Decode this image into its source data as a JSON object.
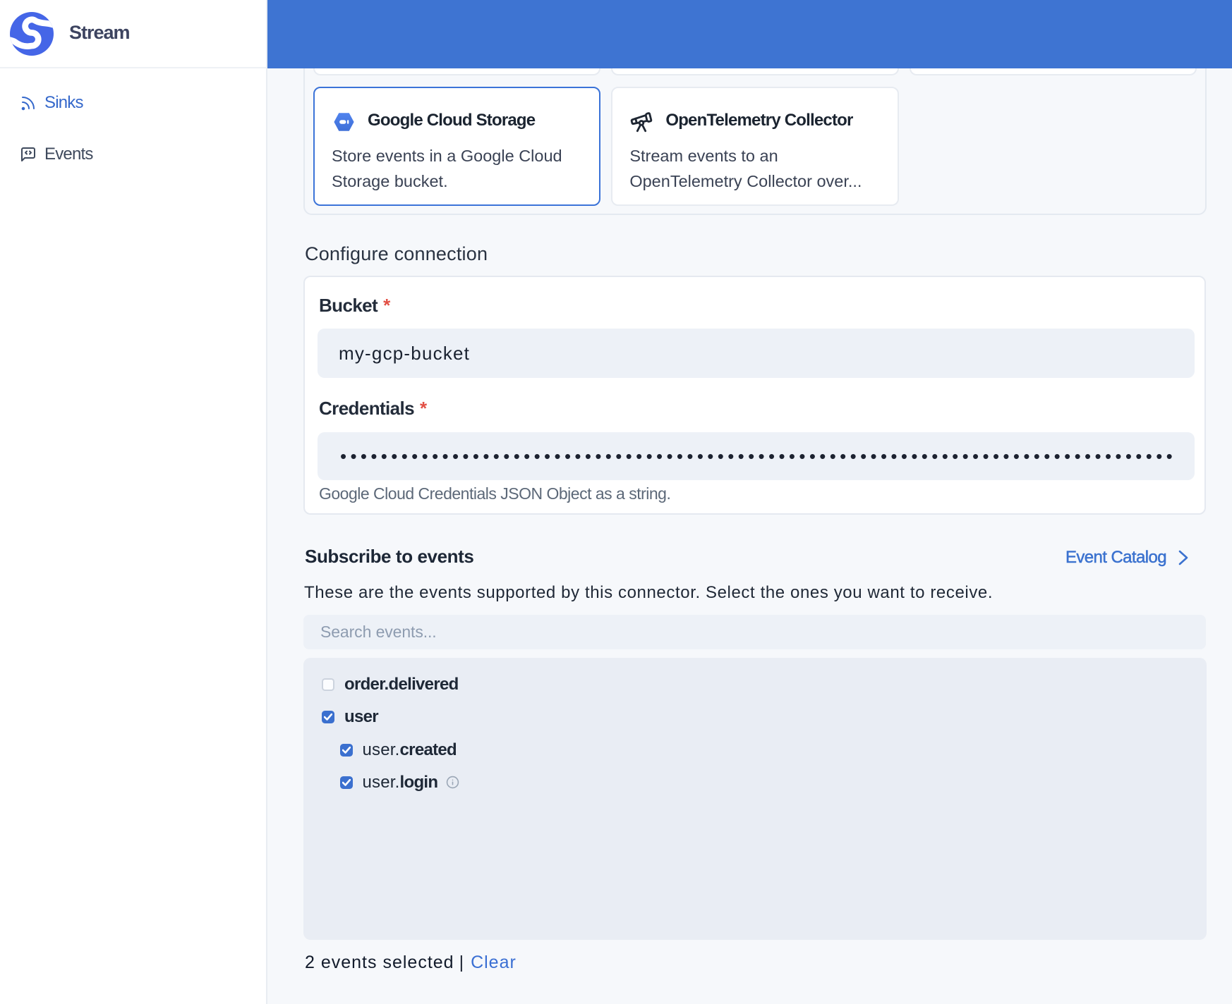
{
  "sidebar": {
    "logo_text": "Stream",
    "items": [
      {
        "label": "Sinks",
        "active": true
      },
      {
        "label": "Events",
        "active": false
      }
    ]
  },
  "connectors": {
    "cards": [
      {
        "name": "Google Cloud Storage",
        "description": "Store events in a Google Cloud Storage bucket.",
        "selected": true
      },
      {
        "name": "OpenTelemetry Collector",
        "description": "Stream events to an OpenTelemetry Collector over...",
        "selected": false
      }
    ]
  },
  "configure": {
    "title": "Configure connection",
    "fields": [
      {
        "label": "Bucket",
        "required_marker": "*",
        "value": "my-gcp-bucket"
      },
      {
        "label": "Credentials",
        "required_marker": "*",
        "masked_value": "••••••••••••••••••••••••••••••••••••••••••••••••••••••••••••••••••••••••••••••••••",
        "help": "Google Cloud Credentials JSON Object as a string."
      }
    ]
  },
  "subscribe": {
    "title": "Subscribe to events",
    "catalog_link": "Event Catalog",
    "description": "These are the events supported by this connector. Select the ones you want to receive.",
    "search_placeholder": "Search events...",
    "events": [
      {
        "name": "order.delivered",
        "checked": false,
        "level": 0
      },
      {
        "name": "user",
        "checked": true,
        "level": 0
      },
      {
        "prefix": "user.",
        "suffix": "created",
        "checked": true,
        "level": 1
      },
      {
        "prefix": "user.",
        "suffix": "login",
        "checked": true,
        "level": 1,
        "has_info": true
      }
    ],
    "footer": {
      "selected_text": "2 events selected",
      "separator": "|",
      "clear_label": "Clear"
    }
  },
  "colors": {
    "header_blue": "#3e74d2",
    "accent_blue": "#3b70cf",
    "link_blue": "#3b72cf",
    "logo_blue": "#4566e7"
  }
}
